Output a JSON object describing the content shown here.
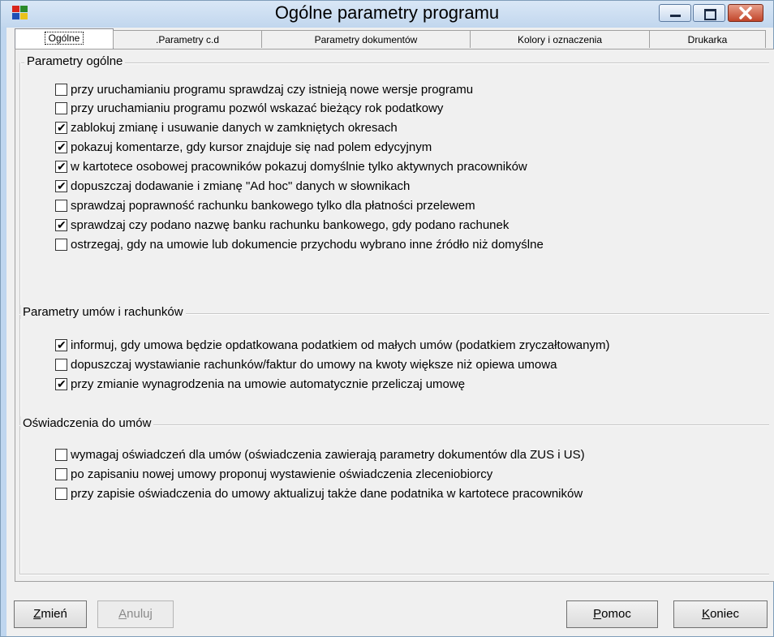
{
  "window": {
    "title": "Ogólne parametry programu"
  },
  "tabs": [
    {
      "label": "Ogólne",
      "active": true
    },
    {
      "label": ".Parametry c.d"
    },
    {
      "label": "Parametry dokumentów"
    },
    {
      "label": "Kolory i oznaczenia"
    },
    {
      "label": "Drukarka"
    }
  ],
  "groups": {
    "general": {
      "title": "Parametry ogólne",
      "options": [
        {
          "label": "przy uruchamianiu programu sprawdzaj czy istnieją nowe wersje programu",
          "checked": false
        },
        {
          "label": "przy uruchamianiu programu pozwól wskazać bieżący rok podatkowy",
          "checked": false
        },
        {
          "label": "zablokuj zmianę i usuwanie danych w zamkniętych okresach",
          "checked": true
        },
        {
          "label": "pokazuj komentarze, gdy kursor znajduje się nad polem edycyjnym",
          "checked": true
        },
        {
          "label": "w kartotece osobowej pracowników pokazuj domyślnie tylko aktywnych pracowników",
          "checked": true
        },
        {
          "label": "dopuszczaj dodawanie i zmianę \"Ad hoc\" danych w słownikach",
          "checked": true
        },
        {
          "label": "sprawdzaj poprawność rachunku bankowego tylko dla płatności przelewem",
          "checked": false
        },
        {
          "label": "sprawdzaj czy podano nazwę banku rachunku bankowego, gdy podano rachunek",
          "checked": true
        },
        {
          "label": "ostrzegaj, gdy na umowie lub dokumencie przychodu wybrano inne źródło niż domyślne",
          "checked": false
        }
      ]
    },
    "contracts": {
      "title": "Parametry umów i rachunków",
      "options": [
        {
          "label": "informuj, gdy umowa będzie opdatkowana podatkiem od małych umów (podatkiem zryczałtowanym)",
          "checked": true
        },
        {
          "label": "dopuszczaj wystawianie rachunków/faktur do umowy na kwoty większe niż opiewa umowa",
          "checked": false
        },
        {
          "label": "przy zmianie wynagrodzenia na umowie automatycznie przeliczaj umowę",
          "checked": true
        }
      ]
    },
    "declarations": {
      "title": "Oświadczenia do umów",
      "options": [
        {
          "label": "wymagaj oświadczeń dla umów (oświadczenia zawierają parametry dokumentów dla ZUS i US)",
          "checked": false
        },
        {
          "label": "po zapisaniu nowej umowy proponuj wystawienie oświadczenia zleceniobiorcy",
          "checked": false
        },
        {
          "label": "przy zapisie oświadczenia do umowy aktualizuj także dane podatnika w kartotece pracowników",
          "checked": false
        }
      ]
    }
  },
  "buttons": {
    "change": {
      "first": "Z",
      "rest": "mień"
    },
    "cancel": {
      "first": "A",
      "rest": "nuluj"
    },
    "help": {
      "first": "P",
      "rest": "omoc"
    },
    "end": {
      "first": "K",
      "rest": "oniec"
    }
  },
  "colors": {
    "titlebar": "#c8dbf0",
    "close_button": "#c1452a",
    "panel": "#f0f0f0"
  }
}
